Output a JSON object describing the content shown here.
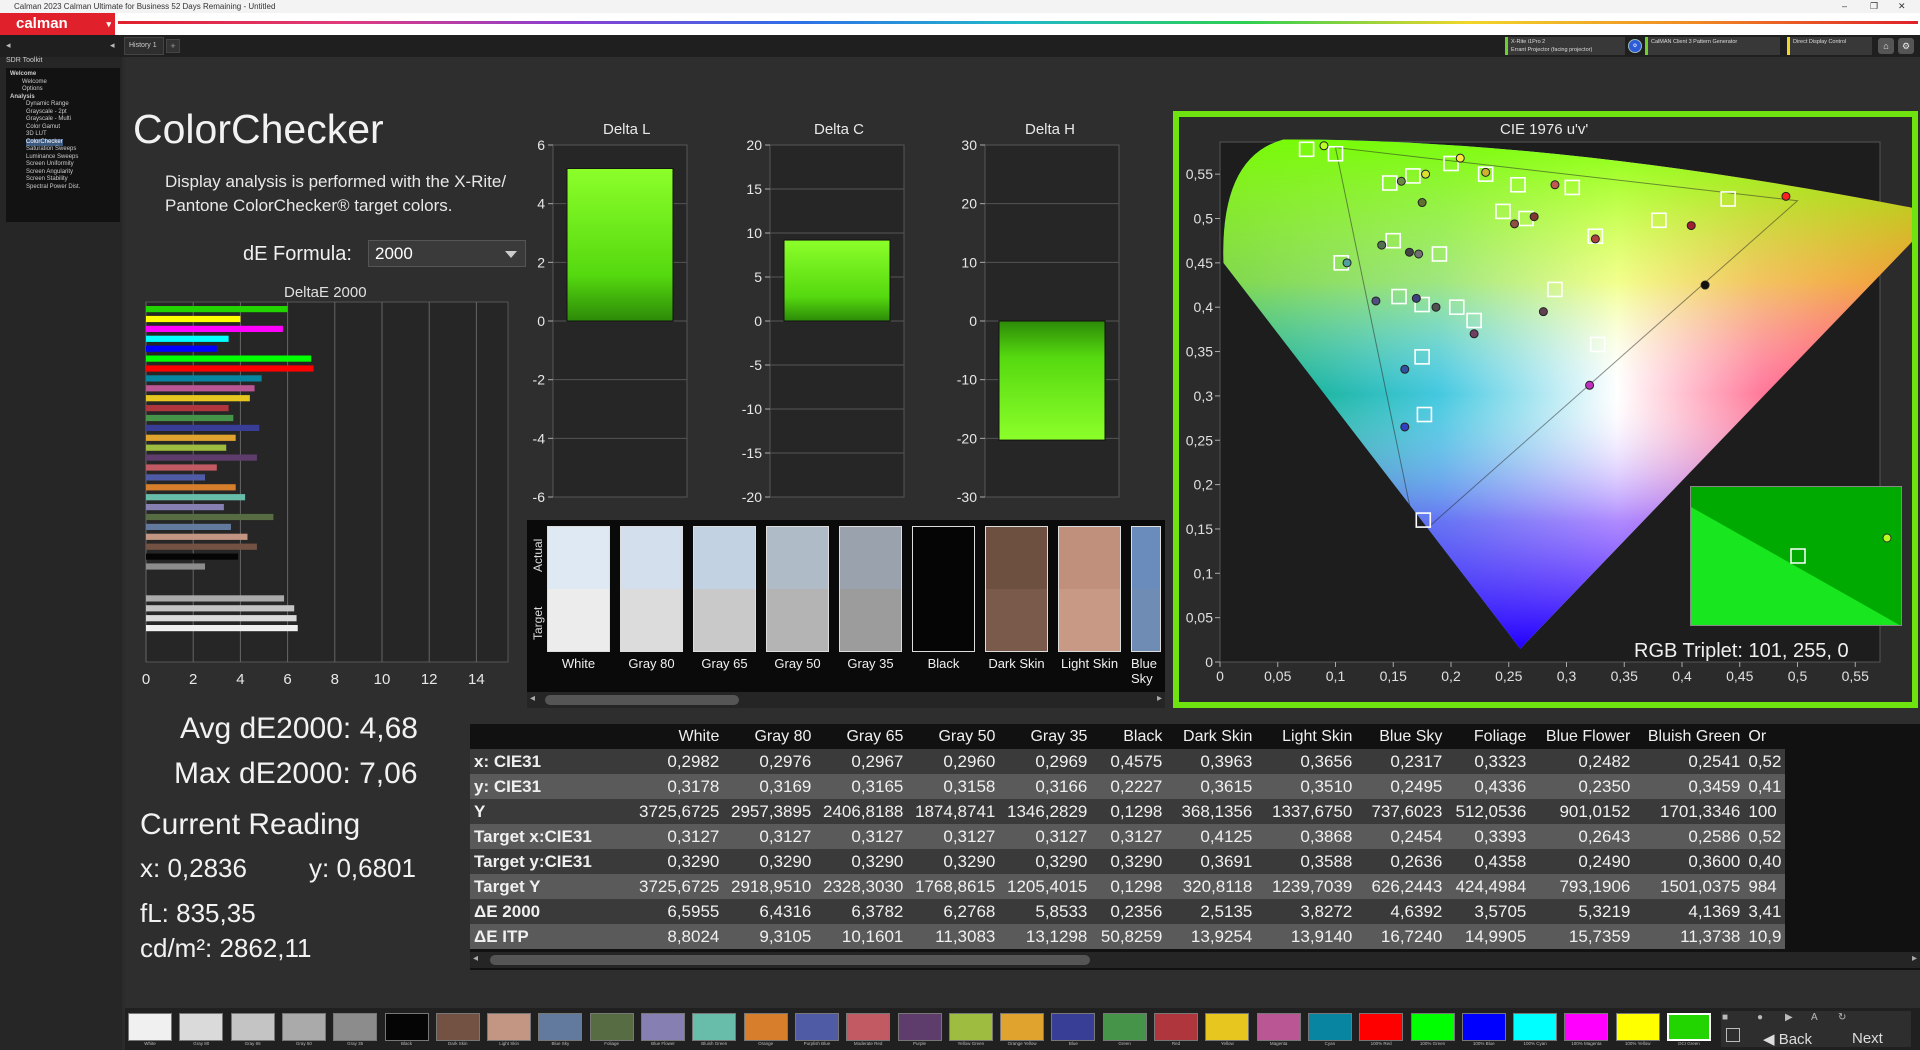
{
  "window": {
    "title": "Calman 2023 Calman Ultimate for Business 52 Days Remaining  - Untitled",
    "logo": "calman",
    "tab": "History 1"
  },
  "toolbar": {
    "meter_name": "X-Rite i1Pro 2",
    "meter_mode": "Errant Projector (facing projector)",
    "pattern_gen": "CalMAN Client 3 Pattern Generator",
    "display_control": "Direct Display Control"
  },
  "sidebar": {
    "label": "SDR Toolkit",
    "items": [
      "Welcome",
      "Welcome",
      "Options",
      "Analysis",
      "Dynamic Range",
      "Grayscale - 2pt",
      "Grayscale - Multi",
      "Color Gamut",
      "3D LUT",
      "ColorChecker",
      "Saturation Sweeps",
      "Luminance Sweeps",
      "Screen Uniformity",
      "Screen Angularity",
      "Screen Stability",
      "Spectral Power Dist."
    ],
    "selected": "ColorChecker"
  },
  "page": {
    "title": "ColorChecker",
    "description_1": "Display analysis is performed with the X-Rite/",
    "description_2": "Pantone ColorChecker® target colors.",
    "de_formula_label": "dE Formula:",
    "de_formula_value": "2000"
  },
  "stats": {
    "avg": "Avg dE2000: 4,68",
    "max": "Max dE2000: 7,06",
    "current_reading_label": "Current Reading",
    "x": "x: 0,2836",
    "y": "y: 0,6801",
    "fl": "fL: 835,35",
    "cdm2": "cd/m²: 2862,11"
  },
  "deltae_chart": {
    "title": "DeltaE 2000",
    "ticks": [
      "0",
      "2",
      "4",
      "6",
      "8",
      "10",
      "12",
      "14"
    ]
  },
  "delta_charts": [
    {
      "title": "Delta L",
      "ticks": [
        "6",
        "4",
        "2",
        "0",
        "-2",
        "-4",
        "-6"
      ],
      "value": 5.2,
      "min": -6,
      "max": 6
    },
    {
      "title": "Delta C",
      "ticks": [
        "20",
        "15",
        "10",
        "5",
        "0",
        "-5",
        "-10",
        "-15",
        "-20"
      ],
      "value": 9.2,
      "min": -20,
      "max": 20
    },
    {
      "title": "Delta H",
      "ticks": [
        "30",
        "20",
        "10",
        "0",
        "-10",
        "-20",
        "-30"
      ],
      "value": -20.3,
      "min": -30,
      "max": 30
    }
  ],
  "swatches": {
    "actual_label": "Actual",
    "target_label": "Target",
    "items": [
      {
        "name": "White",
        "actual": "#dfe9f4",
        "target": "#ececec"
      },
      {
        "name": "Gray 80",
        "actual": "#d3dfec",
        "target": "#dcdcdc"
      },
      {
        "name": "Gray 65",
        "actual": "#c3d2e2",
        "target": "#c9c9c9"
      },
      {
        "name": "Gray 50",
        "actual": "#afbcc8",
        "target": "#b4b4b4"
      },
      {
        "name": "Gray 35",
        "actual": "#9aa3ad",
        "target": "#9c9c9c"
      },
      {
        "name": "Black",
        "actual": "#050505",
        "target": "#050505"
      },
      {
        "name": "Dark Skin",
        "actual": "#6e5040",
        "target": "#7a5a4a"
      },
      {
        "name": "Light Skin",
        "actual": "#c0907c",
        "target": "#c89a86"
      },
      {
        "name": "Blue Sky",
        "actual": "#6a8cbc",
        "target": "#6e8cb4"
      }
    ]
  },
  "cie": {
    "title": "CIE 1976 u'v'",
    "x_ticks": [
      "0",
      "0,05",
      "0,1",
      "0,15",
      "0,2",
      "0,25",
      "0,3",
      "0,35",
      "0,4",
      "0,45",
      "0,5",
      "0,55"
    ],
    "y_ticks": [
      "0",
      "0,05",
      "0,1",
      "0,15",
      "0,2",
      "0,25",
      "0,3",
      "0,35",
      "0,4",
      "0,45",
      "0,5",
      "0,55"
    ],
    "rgb_triplet": "RGB Triplet: 101, 255, 0",
    "inset_color": "#00c800"
  },
  "table": {
    "columns": [
      "",
      "White",
      "Gray 80",
      "Gray 65",
      "Gray 50",
      "Gray 35",
      "Black",
      "Dark Skin",
      "Light Skin",
      "Blue Sky",
      "Foliage",
      "Blue Flower",
      "Bluish Green",
      "Or"
    ],
    "rows": [
      [
        "x: CIE31",
        "0,2982",
        "0,2976",
        "0,2967",
        "0,2960",
        "0,2969",
        "0,4575",
        "0,3963",
        "0,3656",
        "0,2317",
        "0,3323",
        "0,2482",
        "0,2541",
        "0,52"
      ],
      [
        "y: CIE31",
        "0,3178",
        "0,3169",
        "0,3165",
        "0,3158",
        "0,3166",
        "0,2227",
        "0,3615",
        "0,3510",
        "0,2495",
        "0,4336",
        "0,2350",
        "0,3459",
        "0,41"
      ],
      [
        "Y",
        "3725,6725",
        "2957,3895",
        "2406,8188",
        "1874,8741",
        "1346,2829",
        "0,1298",
        "368,1356",
        "1337,6750",
        "737,6023",
        "512,0536",
        "901,0152",
        "1701,3346",
        "100"
      ],
      [
        "Target x:CIE31",
        "0,3127",
        "0,3127",
        "0,3127",
        "0,3127",
        "0,3127",
        "0,3127",
        "0,4125",
        "0,3868",
        "0,2454",
        "0,3393",
        "0,2643",
        "0,2586",
        "0,52"
      ],
      [
        "Target y:CIE31",
        "0,3290",
        "0,3290",
        "0,3290",
        "0,3290",
        "0,3290",
        "0,3290",
        "0,3691",
        "0,3588",
        "0,2636",
        "0,4358",
        "0,2490",
        "0,3600",
        "0,40"
      ],
      [
        "Target Y",
        "3725,6725",
        "2918,9510",
        "2328,3030",
        "1768,8615",
        "1205,4015",
        "0,1298",
        "320,8118",
        "1239,7039",
        "626,2443",
        "424,4984",
        "793,1906",
        "1501,0375",
        "984"
      ],
      [
        "ΔE 2000",
        "6,5955",
        "6,4316",
        "6,3782",
        "6,2768",
        "5,8533",
        "0,2356",
        "2,5135",
        "3,8272",
        "4,6392",
        "3,5705",
        "5,3219",
        "4,1369",
        "3,41"
      ],
      [
        "ΔE ITP",
        "8,8024",
        "9,3105",
        "10,1601",
        "11,3083",
        "13,1298",
        "50,8259",
        "13,9254",
        "13,9140",
        "16,7240",
        "14,9905",
        "15,7359",
        "11,3738",
        "10,9"
      ]
    ]
  },
  "bottom_swatches": [
    {
      "name": "White",
      "color": "#f0f0f0"
    },
    {
      "name": "Gray 80",
      "color": "#dadada"
    },
    {
      "name": "Gray 65",
      "color": "#c4c4c4"
    },
    {
      "name": "Gray 50",
      "color": "#aaaaaa"
    },
    {
      "name": "Gray 35",
      "color": "#8c8c8c"
    },
    {
      "name": "Black",
      "color": "#050505"
    },
    {
      "name": "Dark Skin",
      "color": "#735244"
    },
    {
      "name": "Light Skin",
      "color": "#c29682"
    },
    {
      "name": "Blue Sky",
      "color": "#627a9d"
    },
    {
      "name": "Foliage",
      "color": "#576c43"
    },
    {
      "name": "Blue Flower",
      "color": "#8580b1"
    },
    {
      "name": "Bluish Green",
      "color": "#67bdaa"
    },
    {
      "name": "Orange",
      "color": "#d67e2c"
    },
    {
      "name": "Purplish Blue",
      "color": "#505ba6"
    },
    {
      "name": "Moderate Red",
      "color": "#c15a63"
    },
    {
      "name": "Purple",
      "color": "#5e3c6c"
    },
    {
      "name": "Yellow Green",
      "color": "#9dbc40"
    },
    {
      "name": "Orange Yellow",
      "color": "#e0a32e"
    },
    {
      "name": "Blue",
      "color": "#383d96"
    },
    {
      "name": "Green",
      "color": "#469449"
    },
    {
      "name": "Red",
      "color": "#af363c"
    },
    {
      "name": "Yellow",
      "color": "#e7c71f"
    },
    {
      "name": "Magenta",
      "color": "#bb5695"
    },
    {
      "name": "Cyan",
      "color": "#0885a1"
    },
    {
      "name": "100% Red",
      "color": "#ff0000"
    },
    {
      "name": "100% Green",
      "color": "#00ff00"
    },
    {
      "name": "100% Blue",
      "color": "#0000ff"
    },
    {
      "name": "100% Cyan",
      "color": "#00ffff"
    },
    {
      "name": "100% Magenta",
      "color": "#ff00ff"
    },
    {
      "name": "100% Yellow",
      "color": "#ffff00"
    },
    {
      "name": "DCI Green",
      "color": "#22d400"
    }
  ],
  "nav": {
    "back": "Back",
    "next": "Next"
  }
}
